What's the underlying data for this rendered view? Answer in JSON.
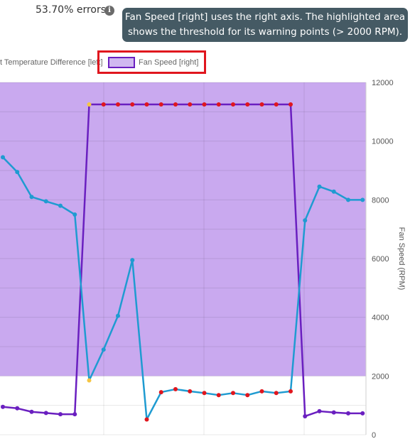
{
  "header": {
    "errors_text": "53.70% errors",
    "info_icon": "info-icon",
    "tooltip_line1": "Fan Speed [right] uses the right axis. The highlighted area",
    "tooltip_line2": "shows the threshold for its warning points (> 2000 RPM)."
  },
  "legend": {
    "left_label": "t Temperature Difference [left]",
    "right_label": "Fan Speed [right]"
  },
  "colors": {
    "threshold_area": "#c9a9ef",
    "fan_speed": "#6a1fc0",
    "temp_diff": "#1f9bd1",
    "warning_point": "#e0161e",
    "highlight_point": "#f5c542",
    "callout": "#e0161e"
  },
  "chart_data": {
    "type": "line",
    "y2label": "Fan Speed (RPM)",
    "y2ticks": [
      "0",
      "2000",
      "4000",
      "6000",
      "8000",
      "10000",
      "12000"
    ],
    "y2lim": [
      0,
      12000
    ],
    "threshold": {
      "series": "Fan Speed [right]",
      "above": 2000
    },
    "x": [
      0,
      1,
      2,
      3,
      4,
      5,
      6,
      7,
      8,
      9,
      10,
      11,
      12,
      13,
      14,
      15,
      16,
      17,
      18,
      19,
      20,
      21,
      22,
      23,
      24,
      25
    ],
    "series": [
      {
        "name": "Fan Speed [right]",
        "axis": "right",
        "values": [
          950,
          900,
          780,
          740,
          700,
          700,
          11250,
          11250,
          11250,
          11250,
          11250,
          11250,
          11250,
          11250,
          11250,
          11250,
          11250,
          11250,
          11250,
          11250,
          11250,
          630,
          800,
          760,
          730,
          730
        ]
      },
      {
        "name": "t Temperature Difference [left]",
        "axis": "left",
        "values": [
          9450,
          8950,
          8100,
          7950,
          7800,
          7500,
          1850,
          2900,
          4050,
          5950,
          520,
          1450,
          1550,
          1480,
          1420,
          1350,
          1420,
          1350,
          1480,
          1420,
          1480,
          7300,
          8450,
          8280,
          8000,
          8000
        ]
      }
    ]
  }
}
